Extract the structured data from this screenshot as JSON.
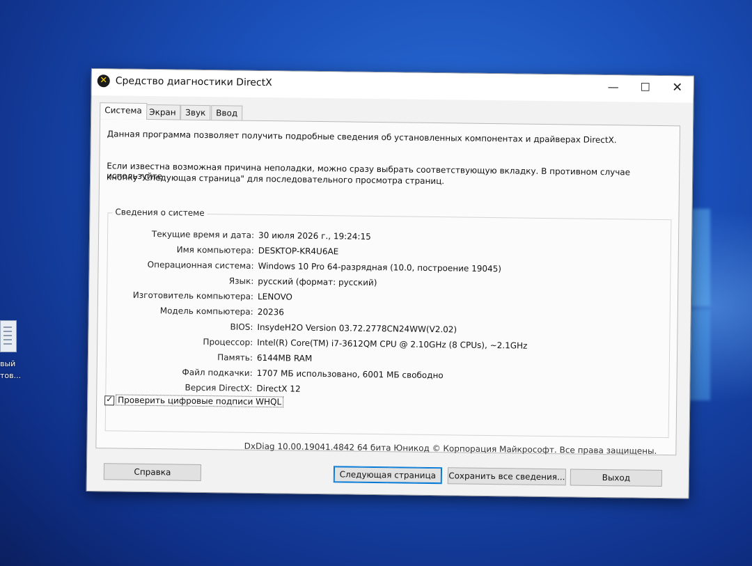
{
  "window": {
    "title": "Средство диагностики DirectX",
    "icon": "x-circle-icon",
    "controls": {
      "minimize": "—",
      "maximize": "☐",
      "close": "✕"
    }
  },
  "tabs": [
    {
      "label": "Система",
      "active": true
    },
    {
      "label": "Экран",
      "active": false
    },
    {
      "label": "Звук",
      "active": false
    },
    {
      "label": "Ввод",
      "active": false
    }
  ],
  "intro": {
    "line1": "Данная программа позволяет получить подробные сведения об установленных компонентах и драйверах DirectX.",
    "line2": "Если известна возможная причина неполадки, можно сразу выбрать соответствующую вкладку. В противном случае используйте",
    "line3": "кнопку \"Следующая страница\" для последовательного просмотра страниц."
  },
  "system_info": {
    "group_label": "Сведения о системе",
    "rows": [
      {
        "key": "Текущие время и дата:",
        "value": "30 июля 2026 г., 19:24:15"
      },
      {
        "key": "Имя компьютера:",
        "value": "DESKTOP-KR4U6AE"
      },
      {
        "key": "Операционная система:",
        "value": "Windows 10 Pro 64-разрядная (10.0, построение 19045)"
      },
      {
        "key": "Язык:",
        "value": "русский (формат: русский)"
      },
      {
        "key": "Изготовитель компьютера:",
        "value": "LENOVO"
      },
      {
        "key": "Модель компьютера:",
        "value": "20236"
      },
      {
        "key": "BIOS:",
        "value": "InsydeH2O Version 03.72.2778CN24WW(V2.02)"
      },
      {
        "key": "Процессор:",
        "value": "Intel(R) Core(TM) i7-3612QM CPU @ 2.10GHz (8 CPUs), ~2.1GHz"
      },
      {
        "key": "Память:",
        "value": "6144MB RAM"
      },
      {
        "key": "Файл подкачки:",
        "value": "1707 МБ использовано, 6001 МБ свободно"
      },
      {
        "key": "Версия DirectX:",
        "value": "DirectX 12"
      }
    ]
  },
  "whql": {
    "label": "Проверить цифровые подписи WHQL",
    "checked": true
  },
  "copyright": "DxDiag 10.00.19041.4842 64 бита Юникод © Корпорация Майкрософт. Все права защищены.",
  "buttons": {
    "help": "Справка",
    "next": "Следующая страница",
    "save": "Сохранить все сведения...",
    "exit": "Выход"
  },
  "desktop": {
    "icon_label_1": "вый",
    "icon_label_2": "тов..."
  }
}
